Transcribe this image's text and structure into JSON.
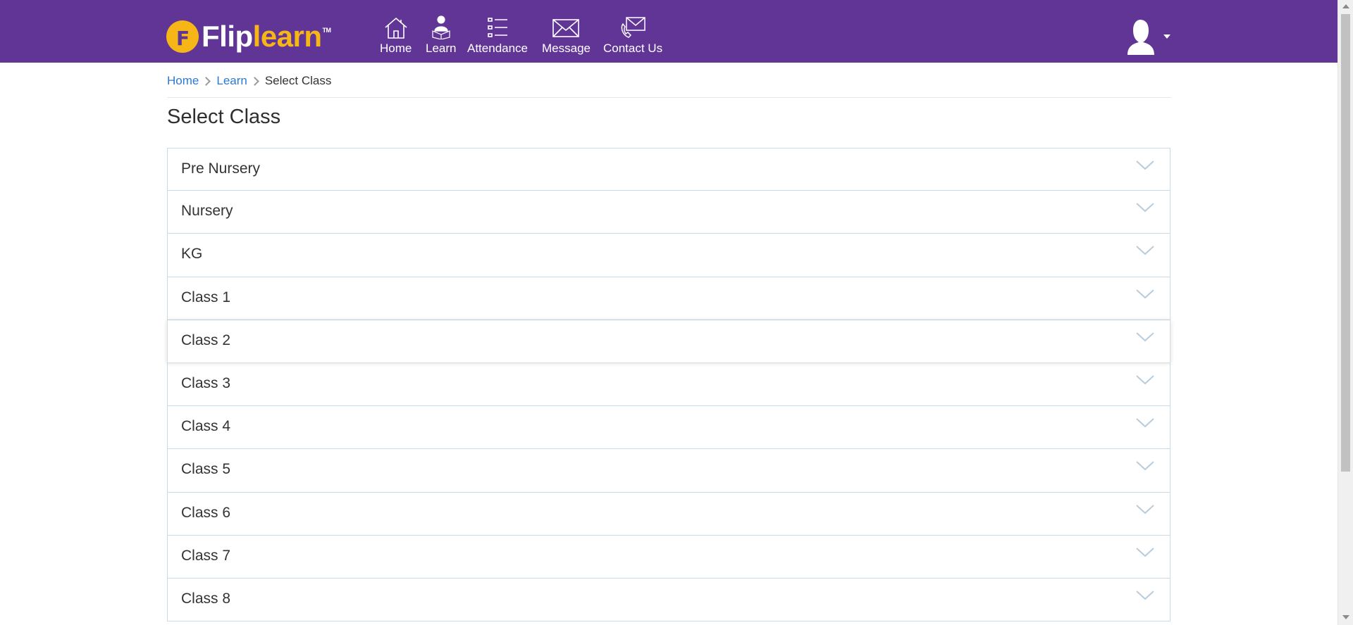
{
  "header": {
    "logo": {
      "flip": "Flip",
      "learn": "learn",
      "tm": "TM"
    },
    "nav": [
      {
        "label": "Home",
        "icon": "home-icon"
      },
      {
        "label": "Learn",
        "icon": "learn-icon"
      },
      {
        "label": "Attendance",
        "icon": "list-icon"
      },
      {
        "label": "Message",
        "icon": "envelope-icon"
      },
      {
        "label": "Contact Us",
        "icon": "contact-icon"
      }
    ],
    "user_menu": {
      "icon": "user-avatar-icon"
    }
  },
  "breadcrumb": [
    {
      "label": "Home",
      "link": true
    },
    {
      "label": "Learn",
      "link": true
    },
    {
      "label": "Select Class",
      "link": false
    }
  ],
  "page": {
    "title": "Select Class"
  },
  "classes": [
    {
      "label": "Pre Nursery"
    },
    {
      "label": "Nursery"
    },
    {
      "label": "KG"
    },
    {
      "label": "Class 1"
    },
    {
      "label": "Class 2"
    },
    {
      "label": "Class 3"
    },
    {
      "label": "Class 4"
    },
    {
      "label": "Class 5"
    },
    {
      "label": "Class 6"
    },
    {
      "label": "Class 7"
    },
    {
      "label": "Class 8"
    }
  ],
  "colors": {
    "header_bg": "#613595",
    "logo_accent": "#f7b617",
    "link": "#2b7bd0",
    "row_border": "#c7dbe8",
    "chevron": "#b9ccdc"
  }
}
